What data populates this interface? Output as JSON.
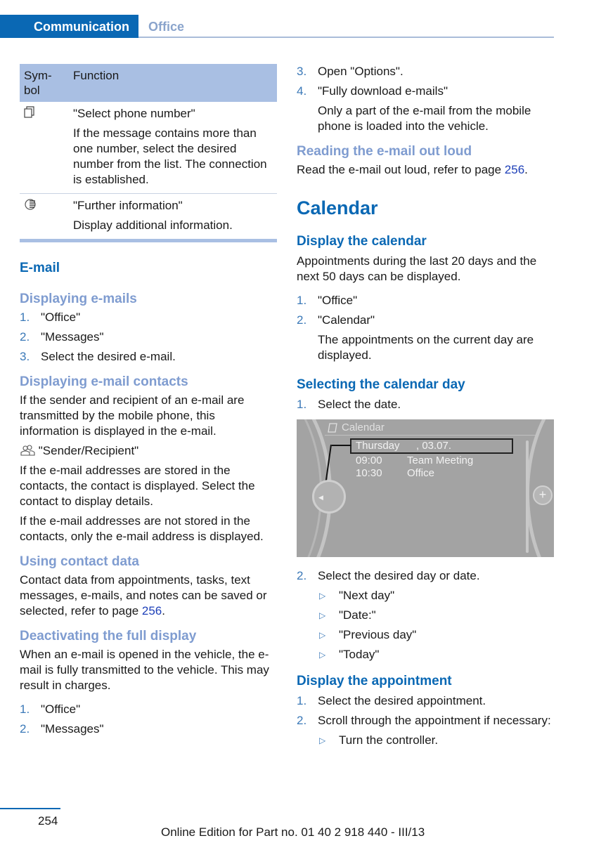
{
  "header": {
    "section": "Communication",
    "subsection": "Office"
  },
  "symbol_table": {
    "headers": [
      "Sym-\nbol",
      "Function"
    ],
    "rows": [
      {
        "icon": "copy-phone-number-icon",
        "title": "\"Select phone number\"",
        "desc": "If the message contains more than one number, select the desired number from the list. The connection is established."
      },
      {
        "icon": "further-information-icon",
        "title": "\"Further information\"",
        "desc": "Display additional information."
      }
    ]
  },
  "left": {
    "email_heading": "E-mail",
    "displaying_emails": {
      "heading": "Displaying e-mails",
      "steps": [
        "\"Office\"",
        "\"Messages\"",
        "Select the desired e-mail."
      ]
    },
    "displaying_contacts": {
      "heading": "Displaying e-mail contacts",
      "intro": "If the sender and recipient of an e-mail are transmitted by the mobile phone, this information is displayed in the e-mail.",
      "icon_item": "\"Sender/Recipient\"",
      "p1": "If the e-mail addresses are stored in the contacts, the contact is displayed. Select the contact to display details.",
      "p2": "If the e-mail addresses are not stored in the contacts, only the e-mail address is displayed."
    },
    "using_contact": {
      "heading": "Using contact data",
      "text": "Contact data from appointments, tasks, text messages, e-mails, and notes can be saved or selected, refer to page ",
      "page": "256",
      "end": "."
    },
    "deactivating": {
      "heading": "Deactivating the full display",
      "text": "When an e-mail is opened in the vehicle, the e-mail is fully transmitted to the vehicle. This may result in charges.",
      "steps": [
        "\"Office\"",
        "\"Messages\""
      ]
    }
  },
  "right": {
    "cont_steps": [
      {
        "num": "3.",
        "text": "Open \"Options\"."
      },
      {
        "num": "4.",
        "text": "\"Fully download e-mails\"",
        "sub": "Only a part of the e-mail from the mobile phone is loaded into the vehicle."
      }
    ],
    "reading": {
      "heading": "Reading the e-mail out loud",
      "text": "Read the e-mail out loud, refer to page ",
      "page": "256",
      "end": "."
    },
    "calendar_heading": "Calendar",
    "display_calendar": {
      "heading": "Display the calendar",
      "text": "Appointments during the last 20 days and the next 50 days can be displayed.",
      "steps": [
        {
          "num": "1.",
          "text": "\"Office\""
        },
        {
          "num": "2.",
          "text": "\"Calendar\"",
          "sub": "The appointments on the current day are displayed."
        }
      ]
    },
    "selecting_day": {
      "heading": "Selecting the calendar day",
      "step1": "Select the date.",
      "screen": {
        "title": "Calendar",
        "selected_day": "Thursday",
        "selected_date": ", 03.07.",
        "appointments": [
          {
            "time": "09:00",
            "title": "Team Meeting"
          },
          {
            "time": "10:30",
            "title": "Office"
          }
        ]
      },
      "step2": "Select the desired day or date.",
      "options": [
        "\"Next day\"",
        "\"Date:\"",
        "\"Previous day\"",
        "\"Today\""
      ]
    },
    "display_appointment": {
      "heading": "Display the appointment",
      "steps": [
        "Select the desired appointment.",
        "Scroll through the appointment if necessary:"
      ],
      "sub": "Turn the controller."
    }
  },
  "footer": {
    "page_number": "254",
    "edition": "Online Edition for Part no. 01 40 2 918 440 - III/13"
  }
}
